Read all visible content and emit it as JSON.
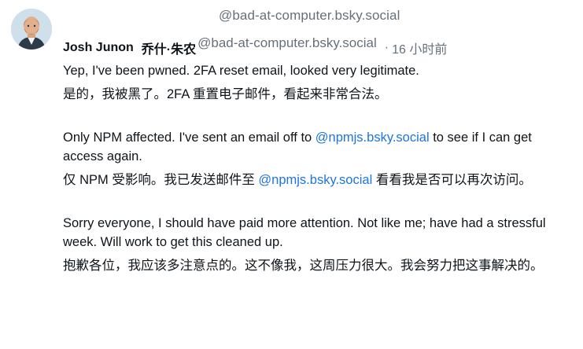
{
  "post": {
    "handle_top": "@bad-at-computer.bsky.social",
    "author_name": "Josh Junon",
    "author_alt_name": "乔什·朱农",
    "handle_inline": "@bad-at-computer.bsky.social",
    "separator": "·",
    "timestamp": "16 小时前",
    "avatar_icon": "avatar-portrait"
  },
  "paragraphs": [
    {
      "original": "Yep, I've been pwned. 2FA reset email, looked very legitimate.",
      "translation": "是的，我被黑了。2FA 重置电子邮件，看起来非常合法。"
    },
    {
      "original_before": "Only NPM affected. I've sent an email off to ",
      "original_mention": "@npmjs.bsky.social",
      "original_after": " to see if I can get access again.",
      "translation_before": "仅 NPM 受影响。我已发送邮件至 ",
      "translation_mention": "@npmjs.bsky.social",
      "translation_after": " 看看我是否可以再次访问。"
    },
    {
      "original": "Sorry everyone, I should have paid more attention. Not like me; have had a stressful week. Will work to get this cleaned up.",
      "translation": "抱歉各位，我应该多注意点的。这不像我，这周压力很大。我会努力把这事解决的。"
    }
  ],
  "colors": {
    "text": "#0f1419",
    "muted": "#66707a",
    "link": "#1d75e0"
  }
}
